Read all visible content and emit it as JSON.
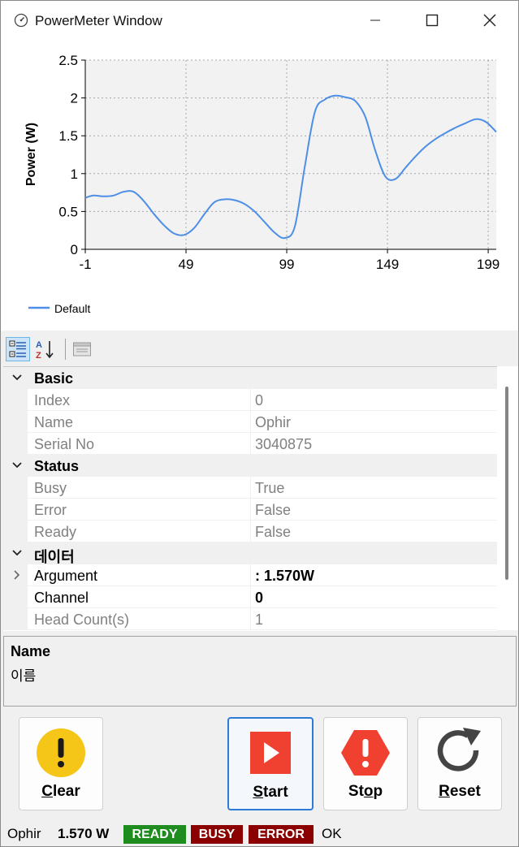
{
  "window": {
    "title": "PowerMeter Window"
  },
  "chart_data": {
    "type": "line",
    "ylabel": "Power (W)",
    "xlabel": "",
    "xlim": [
      -1,
      203
    ],
    "ylim": [
      0,
      2.5
    ],
    "x_ticks": [
      -1,
      49,
      99,
      149,
      199
    ],
    "x_tick_labels": [
      "-1",
      "49",
      "99",
      "149",
      "199"
    ],
    "y_ticks": [
      0,
      0.5,
      1,
      1.5,
      2,
      2.5
    ],
    "y_tick_labels": [
      "0",
      "0.5",
      "1",
      "1.5",
      "2",
      "2.5"
    ],
    "grid": true,
    "legend": "bottom-left",
    "series": [
      {
        "name": "Default",
        "color": "#4d8fe6",
        "x": [
          -1,
          3,
          8,
          13,
          18,
          23,
          28,
          33,
          38,
          43,
          48,
          53,
          58,
          63,
          68,
          73,
          78,
          83,
          88,
          93,
          98,
          103,
          108,
          113,
          118,
          123,
          128,
          133,
          138,
          143,
          148,
          153,
          158,
          163,
          168,
          173,
          178,
          183,
          188,
          193,
          198,
          203
        ],
        "y": [
          0.68,
          0.71,
          0.7,
          0.71,
          0.76,
          0.76,
          0.64,
          0.47,
          0.32,
          0.21,
          0.19,
          0.28,
          0.46,
          0.62,
          0.66,
          0.65,
          0.6,
          0.5,
          0.36,
          0.22,
          0.15,
          0.3,
          1.1,
          1.82,
          1.98,
          2.03,
          2.01,
          1.96,
          1.75,
          1.3,
          0.96,
          0.93,
          1.08,
          1.23,
          1.36,
          1.46,
          1.54,
          1.61,
          1.67,
          1.72,
          1.68,
          1.55
        ]
      }
    ]
  },
  "toolbar": {
    "icons": [
      "categorized-icon",
      "alphabetical-icon",
      "property-pages-icon"
    ]
  },
  "property_grid": {
    "rows": [
      {
        "type": "category",
        "label": "Basic"
      },
      {
        "type": "prop",
        "label": "Index",
        "value": "0",
        "readonly": true
      },
      {
        "type": "prop",
        "label": "Name",
        "value": "Ophir",
        "readonly": true
      },
      {
        "type": "prop",
        "label": "Serial No",
        "value": "3040875",
        "readonly": true
      },
      {
        "type": "category",
        "label": "Status"
      },
      {
        "type": "prop",
        "label": "Busy",
        "value": "True",
        "readonly": true
      },
      {
        "type": "prop",
        "label": "Error",
        "value": "False",
        "readonly": true
      },
      {
        "type": "prop",
        "label": "Ready",
        "value": "False",
        "readonly": true
      },
      {
        "type": "category",
        "label": "데이터"
      },
      {
        "type": "prop",
        "label": "Argument",
        "value": ": 1.570W",
        "readonly": false,
        "bold_value": true,
        "expandable": true
      },
      {
        "type": "prop",
        "label": "Channel",
        "value": "0",
        "readonly": false,
        "bold_value": true
      },
      {
        "type": "prop",
        "label": "Head Count(s)",
        "value": "1",
        "readonly": true
      }
    ]
  },
  "description": {
    "title": "Name",
    "text": "이름"
  },
  "buttons": {
    "clear": {
      "label_mnemonic": "C",
      "label_rest": "lear",
      "icon": "warning-icon",
      "color": "#f5c518"
    },
    "start": {
      "label_mnemonic": "S",
      "label_rest": "tart",
      "icon": "play-icon",
      "color": "#f04030"
    },
    "stop": {
      "label_pre": "St",
      "label_mnemonic": "o",
      "label_rest": "p",
      "icon": "stop-alert-icon",
      "color": "#f04030"
    },
    "reset": {
      "label_mnemonic": "R",
      "label_rest": "eset",
      "icon": "refresh-icon",
      "color": "#444444"
    }
  },
  "status": {
    "device": "Ophir",
    "reading": "1.570 W",
    "ready": {
      "text": "READY",
      "color": "#1e8c1e"
    },
    "busy": {
      "text": "BUSY",
      "color": "#8b0000"
    },
    "error": {
      "text": "ERROR",
      "color": "#8b0000"
    },
    "state": "OK"
  }
}
